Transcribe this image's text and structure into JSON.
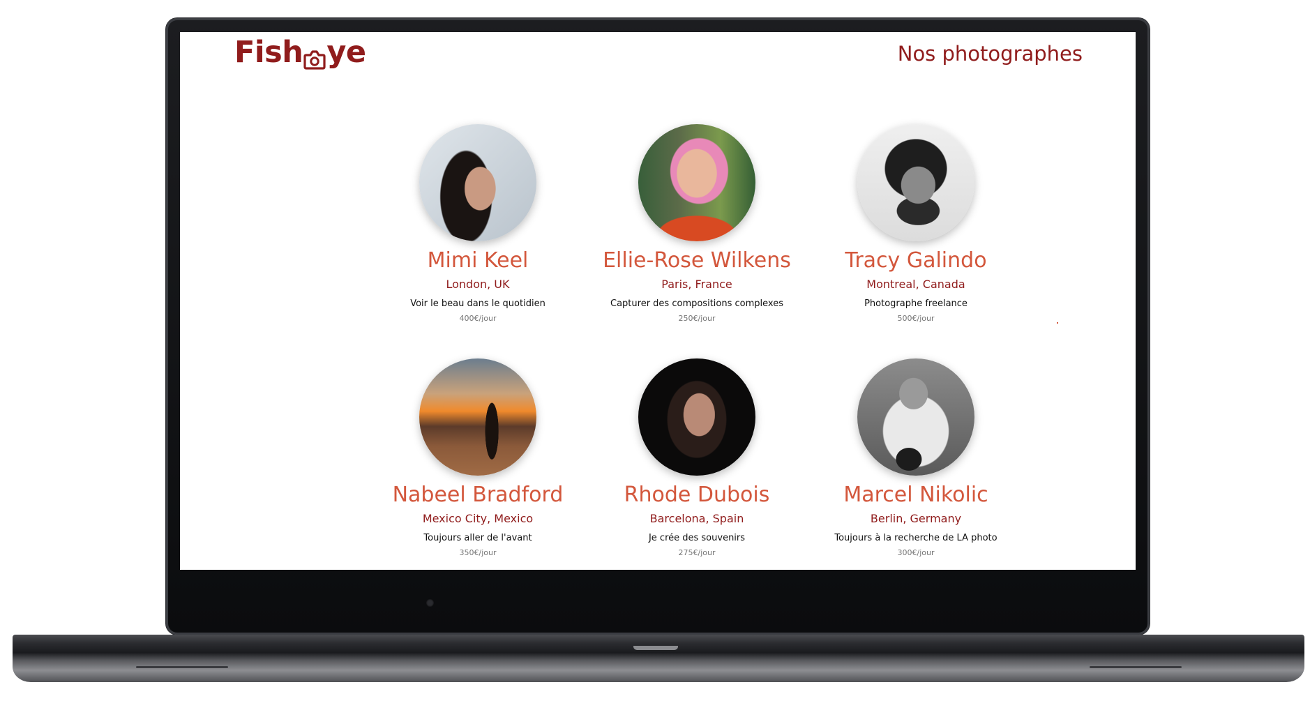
{
  "header": {
    "logo_text_left": "Fish",
    "logo_text_right": "ye",
    "title": "Nos photographes"
  },
  "photographers": [
    {
      "name": "Mimi Keel",
      "location": "London, UK",
      "tagline": "Voir le beau dans le quotidien",
      "price": "400€/jour",
      "avatar": "portrait-woman-dark-hair"
    },
    {
      "name": "Ellie-Rose Wilkens",
      "location": "Paris, France",
      "tagline": "Capturer des compositions complexes",
      "price": "250€/jour",
      "avatar": "portrait-woman-pink-hair-glasses"
    },
    {
      "name": "Tracy Galindo",
      "location": "Montreal, Canada",
      "tagline": "Photographe freelance",
      "price": "500€/jour",
      "avatar": "portrait-man-curly-hair-bw"
    },
    {
      "name": "Nabeel Bradford",
      "location": "Mexico City, Mexico",
      "tagline": "Toujours aller de l'avant",
      "price": "350€/jour",
      "avatar": "silhouette-sunset-tripod"
    },
    {
      "name": "Rhode Dubois",
      "location": "Barcelona, Spain",
      "tagline": "Je crée des souvenirs",
      "price": "275€/jour",
      "avatar": "portrait-woman-dark-background"
    },
    {
      "name": "Marcel Nikolic",
      "location": "Berlin, Germany",
      "tagline": "Toujours à la recherche de LA photo",
      "price": "300€/jour",
      "avatar": "portrait-man-camera-bw"
    }
  ],
  "colors": {
    "primary": "#901c1c",
    "secondary": "#d3573c",
    "text": "#111111",
    "muted": "#757575"
  }
}
